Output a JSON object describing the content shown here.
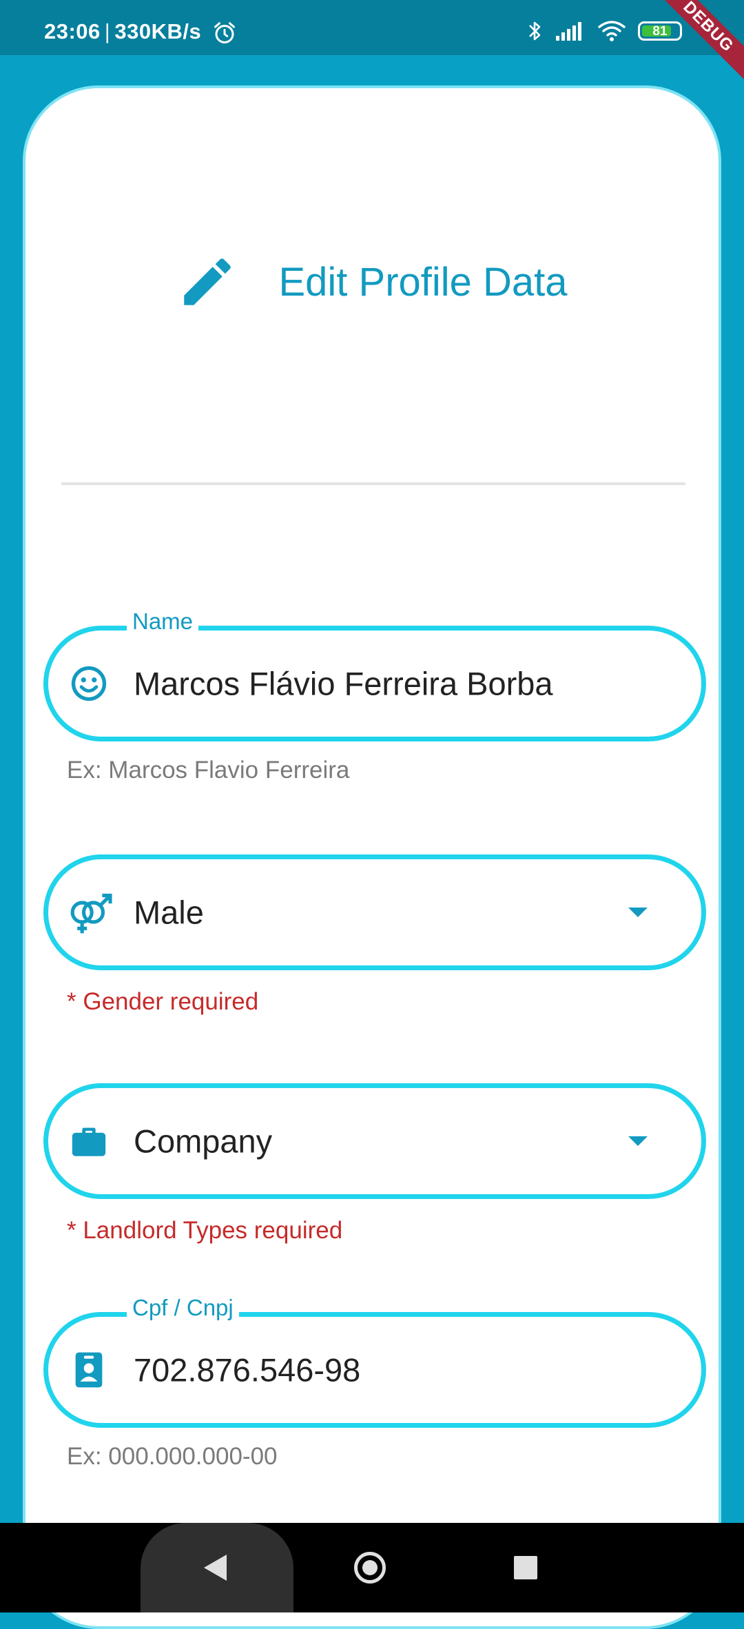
{
  "status_bar": {
    "time": "23:06",
    "separator": "|",
    "network_speed": "330KB/s",
    "battery_level": "81",
    "battery_fraction": 0.81,
    "debug_banner": "DEBUG"
  },
  "header": {
    "title": "Edit Profile Data",
    "icon": "pencil-icon"
  },
  "form": {
    "name": {
      "label": "Name",
      "value": "Marcos Flávio Ferreira Borba",
      "helper": "Ex: Marcos Flavio Ferreira",
      "icon": "smiley-icon"
    },
    "gender": {
      "value": "Male",
      "error": "* Gender required",
      "icon": "gender-icon"
    },
    "landlord_type": {
      "value": "Company",
      "error": "* Landlord Types required",
      "icon": "briefcase-icon"
    },
    "cpf_cnpj": {
      "label": "Cpf / Cnpj",
      "value": "702.876.546-98",
      "helper": "Ex: 000.000.000-00",
      "icon": "id-badge-icon"
    }
  },
  "colors": {
    "primary": "#129ac0",
    "field_border": "#20d4ec",
    "background": "#08a0c4",
    "error": "#c62a2a"
  },
  "nav_bar": {
    "back": "back-icon",
    "home": "home-icon",
    "recent": "recent-apps-icon"
  }
}
